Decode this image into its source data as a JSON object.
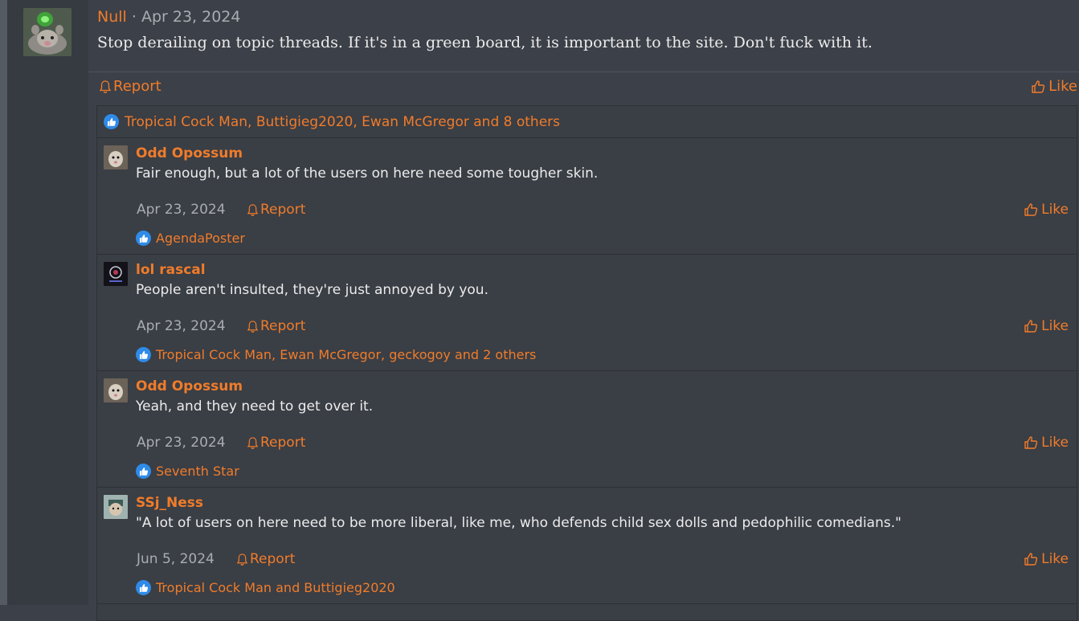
{
  "post": {
    "author": "Null",
    "separator": "·",
    "date": "Apr 23, 2024",
    "body": "Stop derailing on topic threads. If it's in a green board, it is important to the site. Don't fuck with it.",
    "report_label": "Report",
    "like_label": "Like",
    "reactions": "Tropical Cock Man, Buttigieg2020, Ewan McGregor and 8 others",
    "avatar_icon": "cartoon-animal-avatar-icon"
  },
  "comments": [
    {
      "author": "Odd Opossum",
      "text": "Fair enough, but a lot of the users on here need some tougher skin.",
      "date": "Apr 23, 2024",
      "report_label": "Report",
      "like_label": "Like",
      "reactions": "AgendaPoster"
    },
    {
      "author": "lol rascal",
      "text": "People aren't insulted, they're just annoyed by you.",
      "date": "Apr 23, 2024",
      "report_label": "Report",
      "like_label": "Like",
      "reactions": "Tropical Cock Man, Ewan McGregor, geckogoy and 2 others"
    },
    {
      "author": "Odd Opossum",
      "text": "Yeah, and they need to get over it.",
      "date": "Apr 23, 2024",
      "report_label": "Report",
      "like_label": "Like",
      "reactions": "Seventh Star"
    },
    {
      "author": "SSj_Ness",
      "text": "\"A lot of users on here need to be more liberal, like me, who defends child sex dolls and pedophilic comedians.\"",
      "date": "Jun 5, 2024",
      "report_label": "Report",
      "like_label": "Like",
      "reactions": "Tropical Cock Man and Buttigieg2020"
    }
  ],
  "colors": {
    "accent": "#f07c2a",
    "background": "#3c4048",
    "user_column": "#363a41",
    "muted_text": "#a9adb3",
    "reaction_blue": "#2f8be8"
  }
}
